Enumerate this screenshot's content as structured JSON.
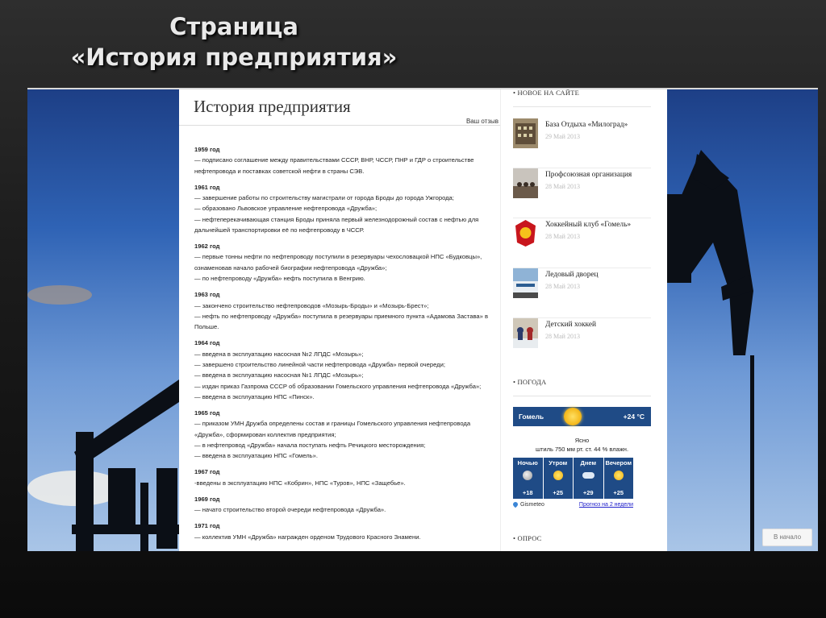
{
  "slide_title": {
    "line1": "Страница",
    "line2": "«История предприятия»"
  },
  "page": {
    "heading": "История предприятия",
    "feedback_link": "Ваш отзыв",
    "history": [
      {
        "year": "1959 год",
        "lines": [
          "— подписано соглашение между правительствами СССР, ВНР, ЧССР, ПНР и ГДР о строительстве нефтепровода и поставках советской нефти в страны СЭВ."
        ]
      },
      {
        "year": "1961 год",
        "lines": [
          "— завершение работы по строительству магистрали от города Броды до города Ужгорода;",
          "— образовано Львовское управление нефтепровода «Дружба»;",
          "— нефтеперекачивающая станция Броды приняла первый железнодорожный состав с нефтью для дальнейшей транспортировки её по нефтепроводу в ЧССР."
        ]
      },
      {
        "year": "1962 год",
        "lines": [
          "— первые тонны нефти по нефтепроводу поступили в резервуары чехословацкой НПС «Будковцы», ознаменовав начало рабочей биографии нефтепровода «Дружба»;",
          "— по нефтепроводу «Дружба» нефть поступила в Венгрию."
        ]
      },
      {
        "year": "1963 год",
        "lines": [
          "— закончено строительство нефтепроводов «Мозырь-Броды» и «Мозырь-Брест»;",
          "— нефть по нефтепроводу «Дружба» поступила в резервуары приемного пункта «Адамова Застава» в Польше."
        ]
      },
      {
        "year": "1964 год",
        "lines": [
          "— введена в эксплуатацию насосная №2 ЛПДС «Мозырь»;",
          "— завершено строительство линейной части нефтепровода «Дружба» первой очереди;",
          "— введена в эксплуатацию насосная №1 ЛПДС «Мозырь»;",
          "— издан приказ Газпрома СССР об образовании Гомельского управления нефтепровода «Дружба»;",
          "— введена в эксплуатацию НПС «Пинск»."
        ]
      },
      {
        "year": "1965 год",
        "lines": [
          "— приказом УМН Дружба определены состав и границы Гомельского управления нефтепровода «Дружба», сформирован коллектив предприятия;",
          "— в нефтепровод «Дружба» начала поступать нефть Речицкого месторождения;",
          "— введена в эксплуатацию НПС «Гомель»."
        ]
      },
      {
        "year": "1967 год",
        "lines": [
          "-введены в эксплуатацию НПС «Кобрин», НПС «Туров», НПС «Защебье»."
        ]
      },
      {
        "year": "1969 год",
        "lines": [
          "— начато строительство второй очереди нефтепровода «Дружба»."
        ]
      },
      {
        "year": "1971 год",
        "lines": [
          "— коллектив УМН «Дружба» награжден орденом Трудового Красного Знамени."
        ]
      }
    ]
  },
  "sidebar": {
    "news_heading": "• НОВОЕ НА САЙТЕ",
    "news": [
      {
        "title": "База Отдыха «Милоград»",
        "date": "29 Май 2013"
      },
      {
        "title": "Профсоюзная организация",
        "date": "28 Май 2013"
      },
      {
        "title": "Хоккейный клуб «Гомель»",
        "date": "28 Май 2013"
      },
      {
        "title": "Ледовый дворец",
        "date": "28 Май 2013"
      },
      {
        "title": "Детский хоккей",
        "date": "28 Май 2013"
      }
    ],
    "weather_heading": "• ПОГОДА",
    "weather": {
      "city": "Гомель",
      "temp": "+24 °C",
      "condition": "Ясно",
      "details": "штиль  750 мм рт. ст.  44 % влажн.",
      "forecast": [
        {
          "label": "Ночью",
          "temp": "+18",
          "icon": "moon-icon"
        },
        {
          "label": "Утром",
          "temp": "+25",
          "icon": "sun-icon"
        },
        {
          "label": "Днем",
          "temp": "+29",
          "icon": "cloud-icon"
        },
        {
          "label": "Вечером",
          "temp": "+25",
          "icon": "partly-cloudy-icon"
        }
      ],
      "provider": "Gismeteo",
      "forecast_link": "Прогноз на 2 недели"
    },
    "poll_heading": "• ОПРОС"
  },
  "back_to_top": "В начало",
  "colors": {
    "weather_panel": "#1f4b86",
    "sky_top": "#1d3f86",
    "sky_bottom": "#a9c5e7"
  }
}
